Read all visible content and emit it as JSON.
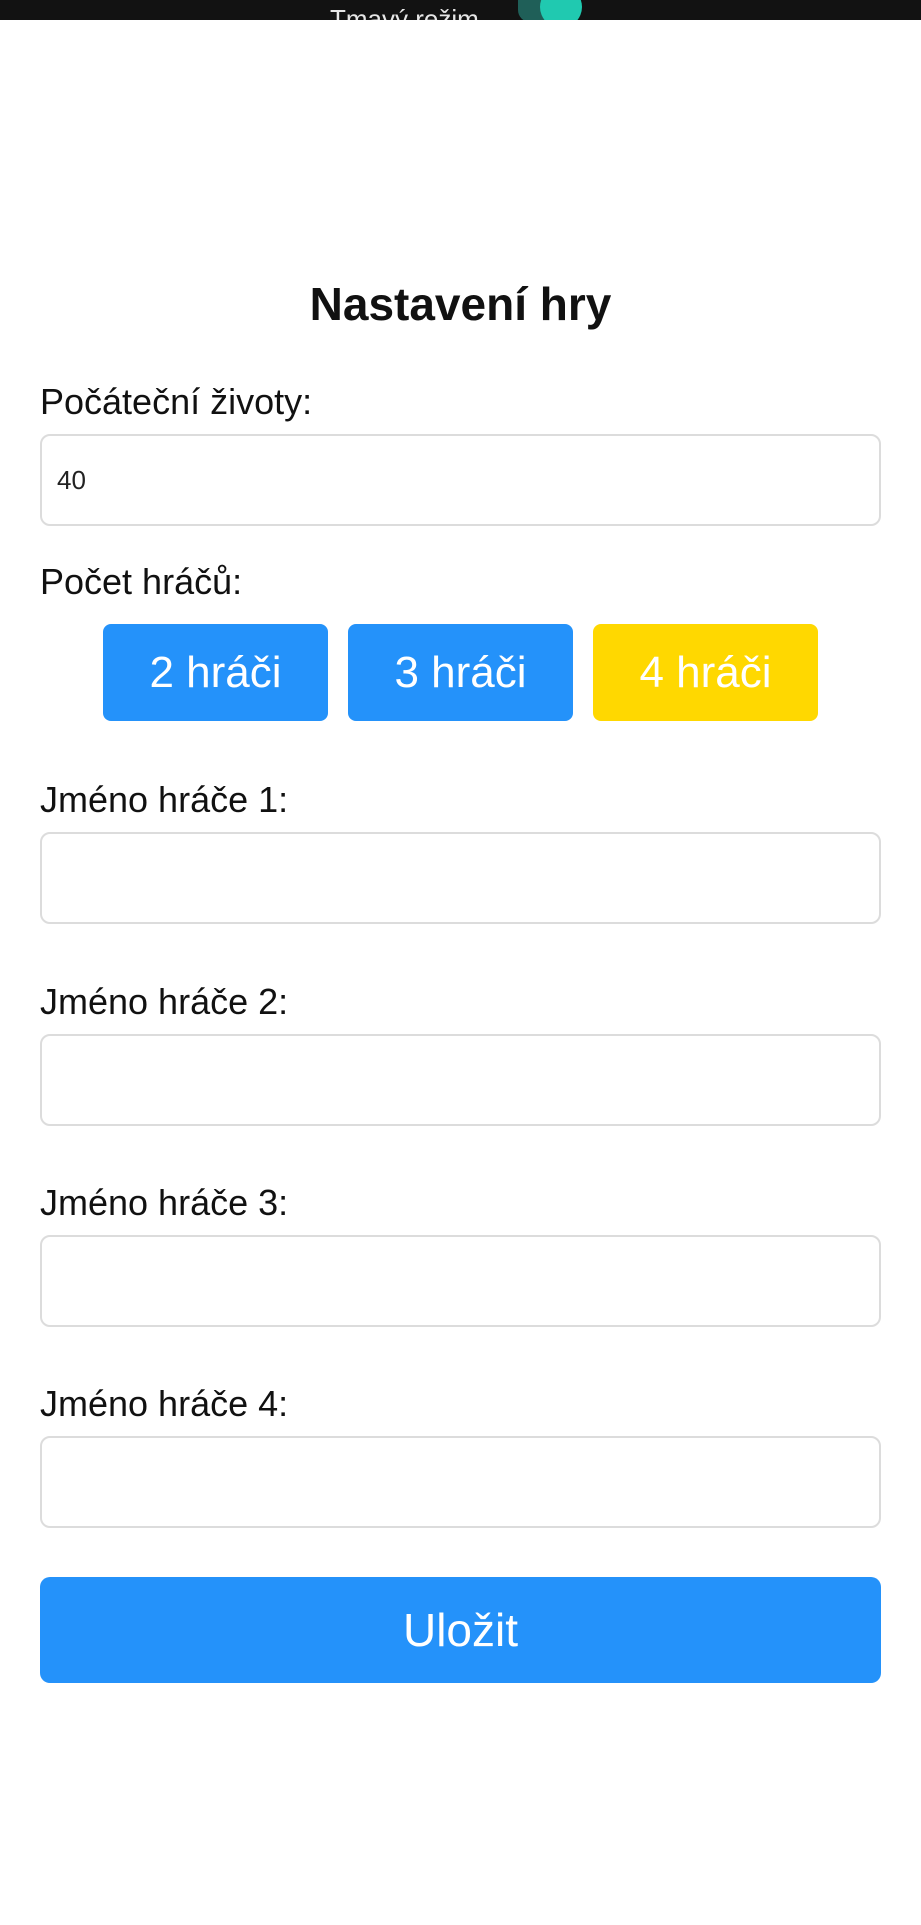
{
  "topbar": {
    "dark_mode_label": "Tmavý režim"
  },
  "title": "Nastavení hry",
  "starting_lives": {
    "label": "Počáteční životy:",
    "value": "40"
  },
  "player_count": {
    "label": "Počet hráčů:",
    "options": [
      {
        "label": "2 hráči",
        "color": "#2492fa"
      },
      {
        "label": "3 hráči",
        "color": "#2492fa"
      },
      {
        "label": "4 hráči",
        "color": "#ffd800"
      }
    ],
    "selected": "4 hráči"
  },
  "players": [
    {
      "label": "Jméno hráče 1:",
      "value": ""
    },
    {
      "label": "Jméno hráče 2:",
      "value": ""
    },
    {
      "label": "Jméno hráče 3:",
      "value": ""
    },
    {
      "label": "Jméno hráče 4:",
      "value": ""
    }
  ],
  "save_label": "Uložit",
  "colors": {
    "accent_blue": "#2492fa",
    "selected_yellow": "#ffd800",
    "toggle_on": "#20c9b0"
  }
}
